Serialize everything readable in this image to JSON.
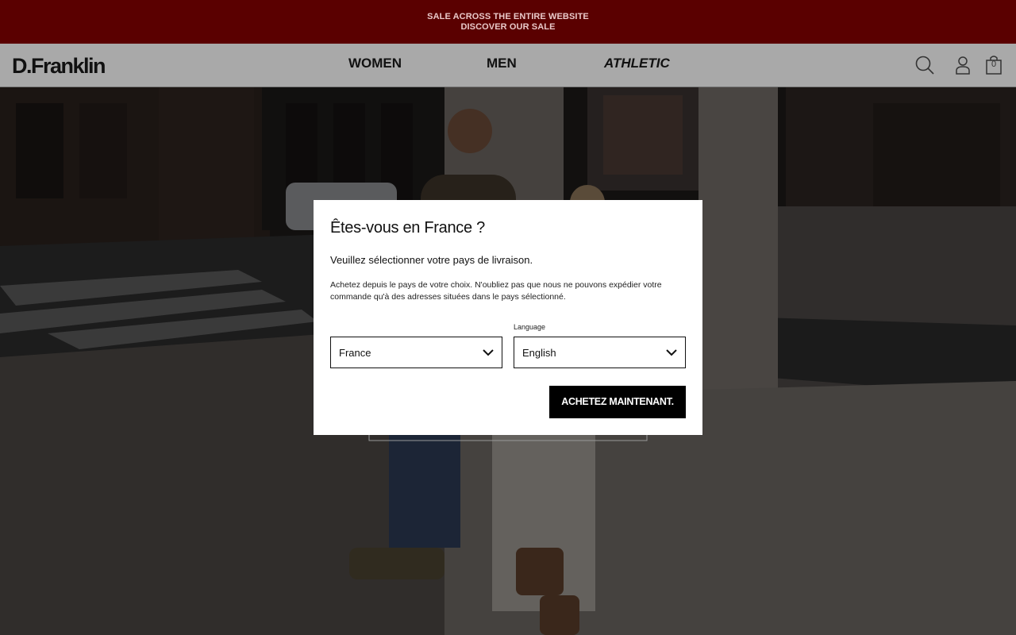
{
  "promo": {
    "line1": "SALE ACROSS THE ENTIRE WEBSITE",
    "line2": "DISCOVER OUR SALE",
    "bg_color": "#5a0000"
  },
  "header": {
    "logo": "D.Franklin",
    "nav": [
      "WOMEN",
      "MEN",
      "ATHLETIC"
    ],
    "icons": [
      "search-icon",
      "account-icon",
      "bag-icon"
    ],
    "bag_count": "0"
  },
  "modal": {
    "title": "Êtes-vous en France ?",
    "subtitle": "Veuillez sélectionner votre pays de livraison.",
    "note": "Achetez depuis le pays de votre choix. N'oubliez pas que nous ne pouvons expédier votre commande qu'à des adresses situées dans le pays sélectionné.",
    "language_label": "Language",
    "country_value": "France",
    "language_value": "English",
    "cta_label": "ACHETEZ MAINTENANT."
  }
}
